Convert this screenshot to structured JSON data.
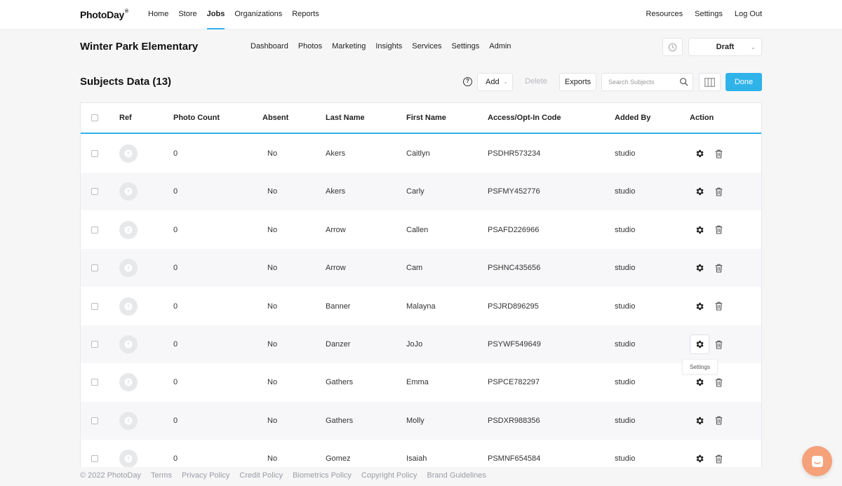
{
  "topnav": {
    "logo_text": "PhotoDay",
    "logo_mark": "®",
    "main_links": [
      "Home",
      "Store",
      "Jobs",
      "Organizations",
      "Reports"
    ],
    "active_link": "Jobs",
    "right_links": [
      "Resources",
      "Settings",
      "Log Out"
    ]
  },
  "job": {
    "title": "Winter Park Elementary",
    "subnav": [
      "Dashboard",
      "Photos",
      "Marketing",
      "Insights",
      "Services",
      "Settings",
      "Admin"
    ],
    "status": "Draft"
  },
  "subjects": {
    "title": "Subjects Data (13)",
    "help_glyph": "?",
    "add_label": "Add",
    "delete_label": "Delete",
    "exports_label": "Exports",
    "search_placeholder": "Search Subjects",
    "done_label": "Done"
  },
  "table": {
    "headers": [
      "Ref",
      "Photo Count",
      "Absent",
      "Last Name",
      "First Name",
      "Access/Opt-In Code",
      "Added By",
      "Action"
    ],
    "rows": [
      {
        "photo_count": "0",
        "absent": "No",
        "last_name": "Akers",
        "first_name": "Caitlyn",
        "code": "PSDHR573234",
        "added_by": "studio"
      },
      {
        "photo_count": "0",
        "absent": "No",
        "last_name": "Akers",
        "first_name": "Carly",
        "code": "PSFMY452776",
        "added_by": "studio"
      },
      {
        "photo_count": "0",
        "absent": "No",
        "last_name": "Arrow",
        "first_name": "Callen",
        "code": "PSAFD226966",
        "added_by": "studio"
      },
      {
        "photo_count": "0",
        "absent": "No",
        "last_name": "Arrow",
        "first_name": "Cam",
        "code": "PSHNC435656",
        "added_by": "studio"
      },
      {
        "photo_count": "0",
        "absent": "No",
        "last_name": "Banner",
        "first_name": "Malayna",
        "code": "PSJRD896295",
        "added_by": "studio"
      },
      {
        "photo_count": "0",
        "absent": "No",
        "last_name": "Danzer",
        "first_name": "JoJo",
        "code": "PSYWF549649",
        "added_by": "studio"
      },
      {
        "photo_count": "0",
        "absent": "No",
        "last_name": "Gathers",
        "first_name": "Emma",
        "code": "PSPCE782297",
        "added_by": "studio"
      },
      {
        "photo_count": "0",
        "absent": "No",
        "last_name": "Gathers",
        "first_name": "Molly",
        "code": "PSDXR988356",
        "added_by": "studio"
      },
      {
        "photo_count": "0",
        "absent": "No",
        "last_name": "Gomez",
        "first_name": "Isaiah",
        "code": "PSMNF654584",
        "added_by": "studio"
      }
    ],
    "tooltip": "Settings"
  },
  "footer": {
    "links": [
      "© 2022 PhotoDay",
      "Terms",
      "Privacy Policy",
      "Credit Policy",
      "Biometrics Policy",
      "Copyright Policy",
      "Brand Guidelines"
    ]
  },
  "colors": {
    "accent": "#2fb3e9",
    "chat": "#f5a17a",
    "row_alt": "#f7f7f9"
  },
  "icons": {
    "clock": "clock-icon",
    "search": "search-icon",
    "columns": "columns-icon",
    "avatar": "user-placeholder-icon",
    "gear": "gear-icon",
    "trash": "trash-icon",
    "chat": "chat-icon"
  }
}
